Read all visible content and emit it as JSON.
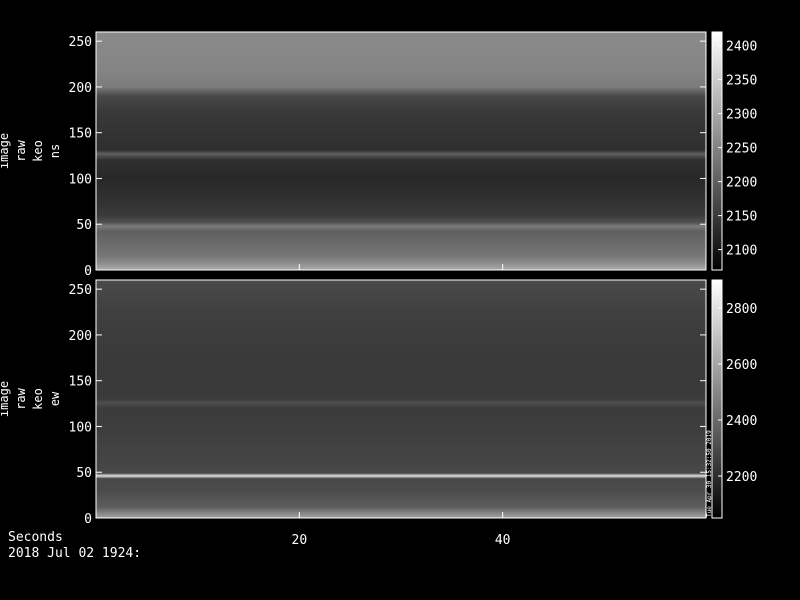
{
  "chart_data": [
    {
      "type": "heatmap",
      "title": "",
      "ylabel_lines": [
        "image",
        "raw",
        "keo",
        "ns"
      ],
      "x_range": [
        0,
        60
      ],
      "ylim": [
        0,
        260
      ],
      "yticks": [
        0,
        50,
        100,
        150,
        200,
        250
      ],
      "colorbar": {
        "range": [
          2070,
          2420
        ],
        "ticks": [
          2100,
          2150,
          2200,
          2250,
          2300,
          2350,
          2400
        ]
      },
      "row_profile": [
        {
          "y": 0,
          "value": 2300
        },
        {
          "y": 3,
          "value": 2290
        },
        {
          "y": 8,
          "value": 2260
        },
        {
          "y": 15,
          "value": 2235
        },
        {
          "y": 25,
          "value": 2220
        },
        {
          "y": 35,
          "value": 2210
        },
        {
          "y": 42,
          "value": 2200
        },
        {
          "y": 48,
          "value": 2240
        },
        {
          "y": 52,
          "value": 2180
        },
        {
          "y": 60,
          "value": 2150
        },
        {
          "y": 80,
          "value": 2135
        },
        {
          "y": 100,
          "value": 2125
        },
        {
          "y": 120,
          "value": 2135
        },
        {
          "y": 127,
          "value": 2200
        },
        {
          "y": 131,
          "value": 2135
        },
        {
          "y": 150,
          "value": 2140
        },
        {
          "y": 175,
          "value": 2150
        },
        {
          "y": 190,
          "value": 2170
        },
        {
          "y": 200,
          "value": 2240
        },
        {
          "y": 215,
          "value": 2250
        },
        {
          "y": 235,
          "value": 2255
        },
        {
          "y": 255,
          "value": 2260
        }
      ]
    },
    {
      "type": "heatmap",
      "title": "",
      "ylabel_lines": [
        "image",
        "raw",
        "keo",
        "ew"
      ],
      "x_range": [
        0,
        60
      ],
      "ylim": [
        0,
        260
      ],
      "yticks": [
        0,
        50,
        100,
        150,
        200,
        250
      ],
      "colorbar": {
        "range": [
          2050,
          2900
        ],
        "ticks": [
          2200,
          2400,
          2600,
          2800
        ]
      },
      "side_annotation": "Tue Apr 30 15:32:50 2019",
      "row_profile": [
        {
          "y": 0,
          "value": 2600
        },
        {
          "y": 5,
          "value": 2500
        },
        {
          "y": 12,
          "value": 2360
        },
        {
          "y": 30,
          "value": 2300
        },
        {
          "y": 43,
          "value": 2290
        },
        {
          "y": 46,
          "value": 2800
        },
        {
          "y": 49,
          "value": 2290
        },
        {
          "y": 60,
          "value": 2280
        },
        {
          "y": 90,
          "value": 2260
        },
        {
          "y": 120,
          "value": 2245
        },
        {
          "y": 126,
          "value": 2310
        },
        {
          "y": 130,
          "value": 2245
        },
        {
          "y": 160,
          "value": 2240
        },
        {
          "y": 200,
          "value": 2250
        },
        {
          "y": 230,
          "value": 2265
        },
        {
          "y": 250,
          "value": 2285
        },
        {
          "y": 258,
          "value": 2295
        }
      ]
    }
  ],
  "x_axis": {
    "ticks": [
      20,
      40
    ],
    "label": "Seconds",
    "date": "2018 Jul 02 1924:"
  }
}
